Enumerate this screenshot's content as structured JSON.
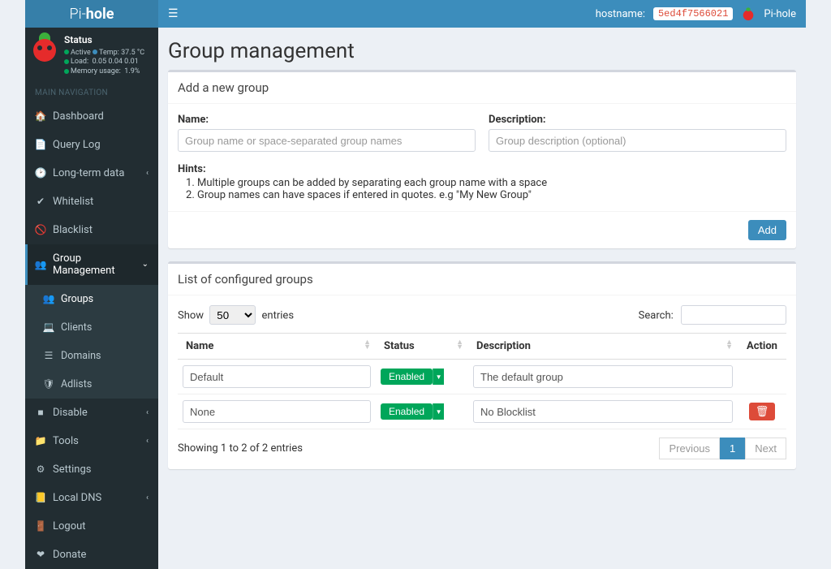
{
  "brand": {
    "prefix": "Pi-",
    "suffix": "hole"
  },
  "topbar": {
    "hostname_label": "hostname:",
    "hostname_value": "5ed4f7566021",
    "app_name": "Pi-hole"
  },
  "status": {
    "title": "Status",
    "active": "Active",
    "temp_label": "Temp:",
    "temp_value": "37.5 °C",
    "load_label": "Load:",
    "load_values": "0.05  0.04  0.01",
    "mem_label": "Memory usage:",
    "mem_value": "1.9%"
  },
  "nav": {
    "header": "MAIN NAVIGATION",
    "dashboard": "Dashboard",
    "querylog": "Query Log",
    "longterm": "Long-term data",
    "whitelist": "Whitelist",
    "blacklist": "Blacklist",
    "groupmgmt": "Group Management",
    "groups": "Groups",
    "clients": "Clients",
    "domains": "Domains",
    "adlists": "Adlists",
    "disable": "Disable",
    "tools": "Tools",
    "settings": "Settings",
    "localdns": "Local DNS",
    "logout": "Logout",
    "donate": "Donate"
  },
  "page": {
    "title": "Group management"
  },
  "add_box": {
    "header": "Add a new group",
    "name_label": "Name:",
    "name_placeholder": "Group name or space-separated group names",
    "desc_label": "Description:",
    "desc_placeholder": "Group description (optional)",
    "hints_title": "Hints:",
    "hint1": "Multiple groups can be added by separating each group name with a space",
    "hint2": "Group names can have spaces if entered in quotes. e.g \"My New Group\"",
    "add_button": "Add"
  },
  "list_box": {
    "header": "List of configured groups",
    "show_label": "Show",
    "show_value": "50",
    "entries_label": "entries",
    "search_label": "Search:",
    "col_name": "Name",
    "col_status": "Status",
    "col_desc": "Description",
    "col_action": "Action",
    "rows": [
      {
        "name": "Default",
        "status": "Enabled",
        "desc": "The default group",
        "deletable": false
      },
      {
        "name": "None",
        "status": "Enabled",
        "desc": "No Blocklist",
        "deletable": true
      }
    ],
    "info": "Showing 1 to 2 of 2 entries",
    "prev": "Previous",
    "page1": "1",
    "next": "Next"
  }
}
